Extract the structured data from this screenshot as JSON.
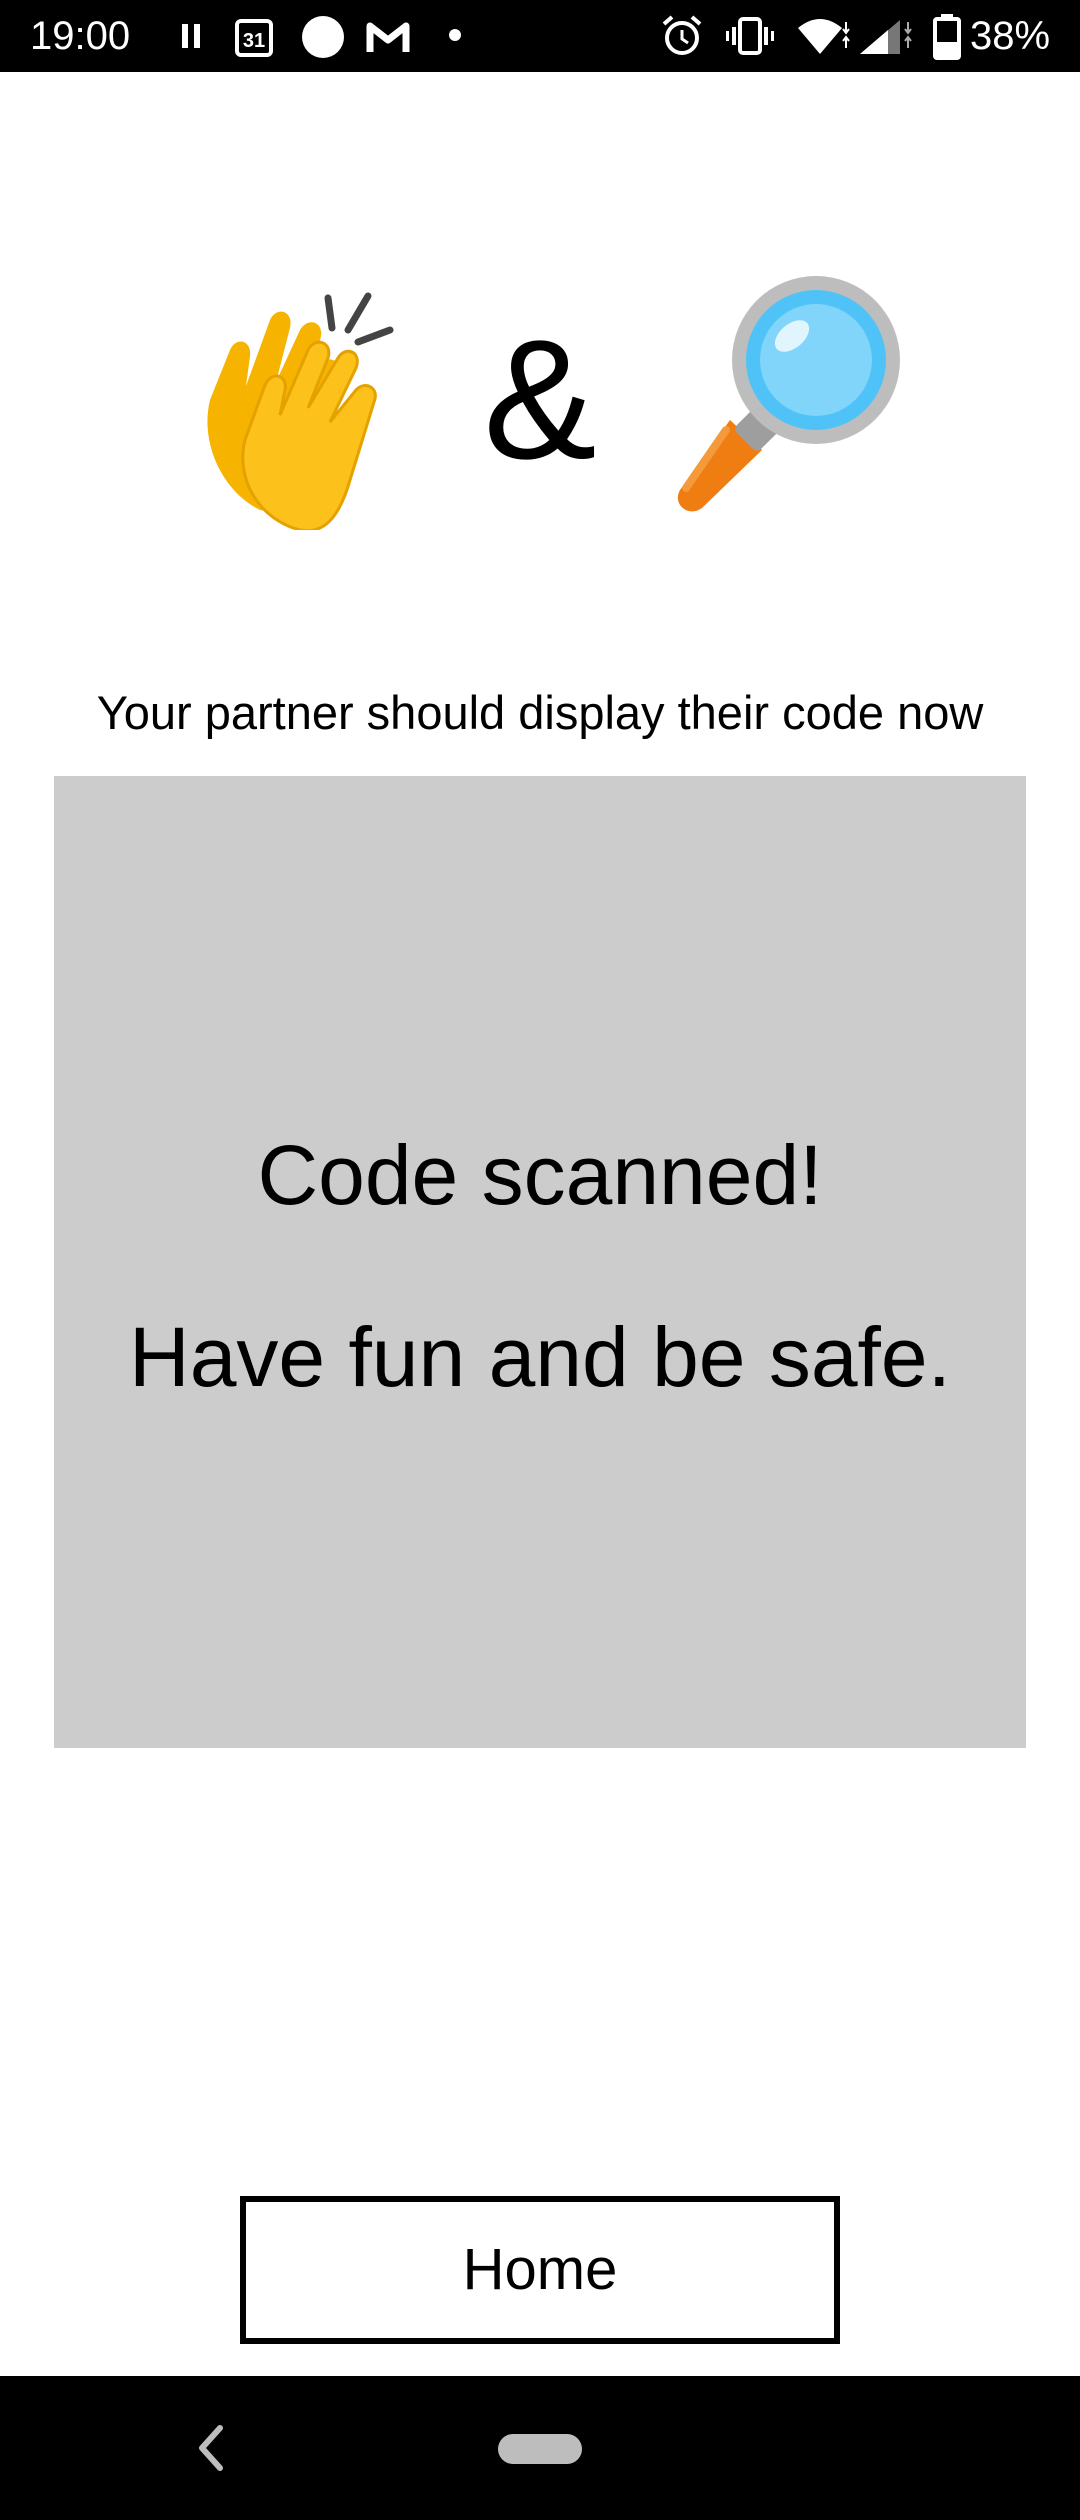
{
  "status_bar": {
    "time": "19:00",
    "calendar_day": "31",
    "battery": "38%",
    "icons": [
      "pause-icon",
      "calendar-icon",
      "circle-icon",
      "gmail-icon",
      "dot-icon",
      "alarm-icon",
      "vibrate-icon",
      "wifi-icon",
      "signal-icon",
      "battery-icon"
    ]
  },
  "header": {
    "emoji_left": "clapping-hands",
    "ampersand": "&",
    "emoji_right": "magnifying-glass"
  },
  "main": {
    "instruction": "Your partner should display their code now",
    "scan_message_line1": "Code scanned!",
    "scan_message_line2": "Have fun and be safe.",
    "panel_color": "#cccccc"
  },
  "footer": {
    "home_label": "Home"
  },
  "nav_bar": {
    "icons": [
      "back-icon",
      "home-pill-icon"
    ]
  }
}
